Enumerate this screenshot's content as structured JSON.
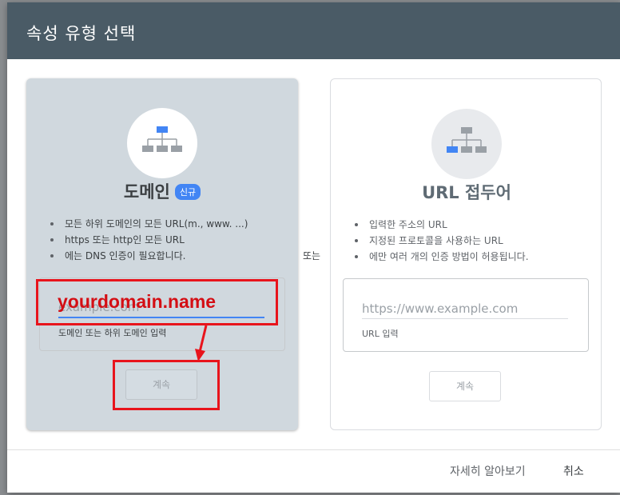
{
  "dialog": {
    "title": "속성 유형 선택",
    "or_label": "또는",
    "footer": {
      "learn_more": "자세히 알아보기",
      "cancel": "취소"
    }
  },
  "domain_card": {
    "title": "도메인",
    "badge": "신규",
    "bullets": [
      "모든 하위 도메인의 모든 URL(m., www. ...)",
      "https 또는 http인 모든 URL",
      "에는 DNS 인증이 필요합니다."
    ],
    "input": {
      "placeholder": "example.com",
      "value": "",
      "help": "도메인 또는 하위 도메인 입력"
    },
    "continue_label": "계속",
    "icon": "domain-tree-icon"
  },
  "url_card": {
    "title": "URL 접두어",
    "bullets": [
      "입력한 주소의 URL",
      "지정된 프로토콜을 사용하는 URL",
      "에만 여러 개의 인증 방법이 허용됩니다."
    ],
    "input": {
      "placeholder": "https://www.example.com",
      "value": "",
      "help": "URL 입력"
    },
    "continue_label": "계속",
    "icon": "url-prefix-tree-icon"
  },
  "annotation": {
    "text": "yourdomain.name",
    "color": "#e8141c"
  },
  "colors": {
    "header": "#4a5b66",
    "accent": "#4285f4",
    "domain_card_bg": "#d0d8de"
  }
}
